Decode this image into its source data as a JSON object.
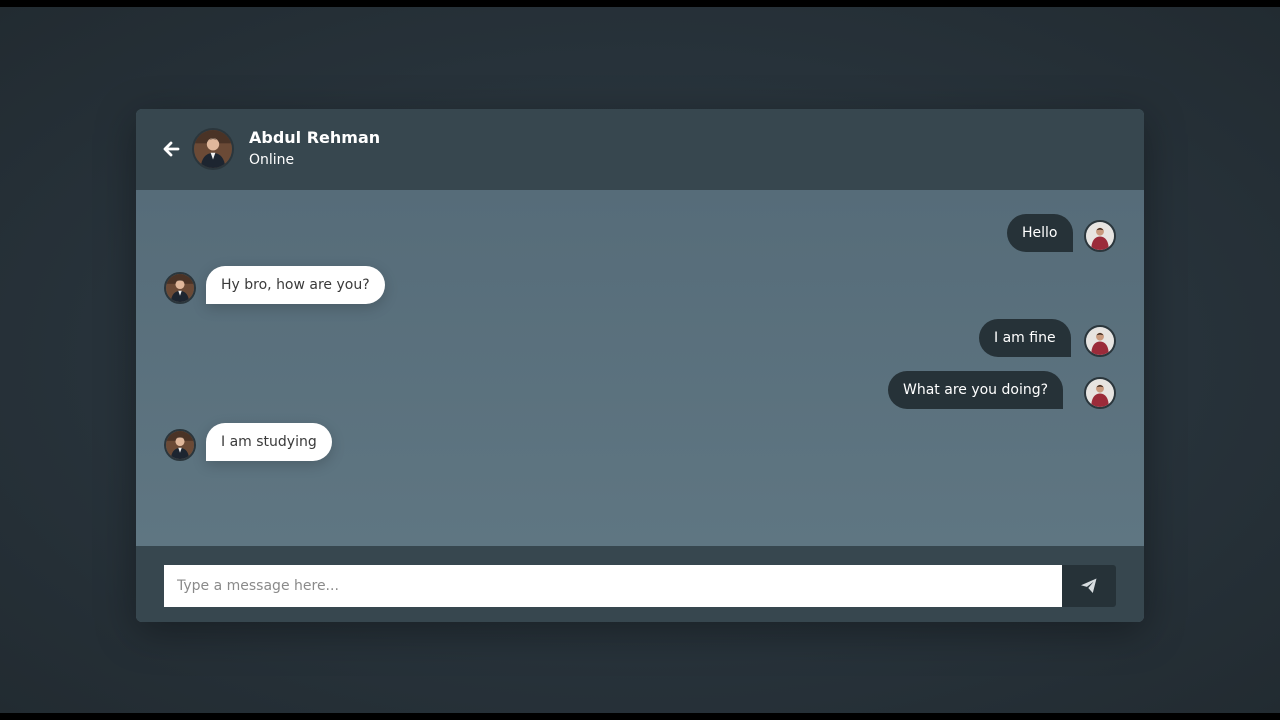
{
  "colors": {
    "header_bg": "#37474f",
    "body_bg": "#566c79",
    "sent_bubble": "#263238",
    "received_bubble": "#ffffff",
    "send_button": "#263238"
  },
  "header": {
    "back_icon": "arrow-left-icon",
    "contact_name": "Abdul Rehman",
    "status": "Online"
  },
  "messages": [
    {
      "direction": "sent",
      "text": "Hello"
    },
    {
      "direction": "received",
      "text": "Hy bro, how are you?"
    },
    {
      "direction": "sent",
      "text": "I am fine"
    },
    {
      "direction": "sent",
      "text": "What are you doing?"
    },
    {
      "direction": "received",
      "text": "I am studying"
    }
  ],
  "composer": {
    "placeholder": "Type a message here...",
    "value": "",
    "send_icon": "paper-plane-icon"
  }
}
